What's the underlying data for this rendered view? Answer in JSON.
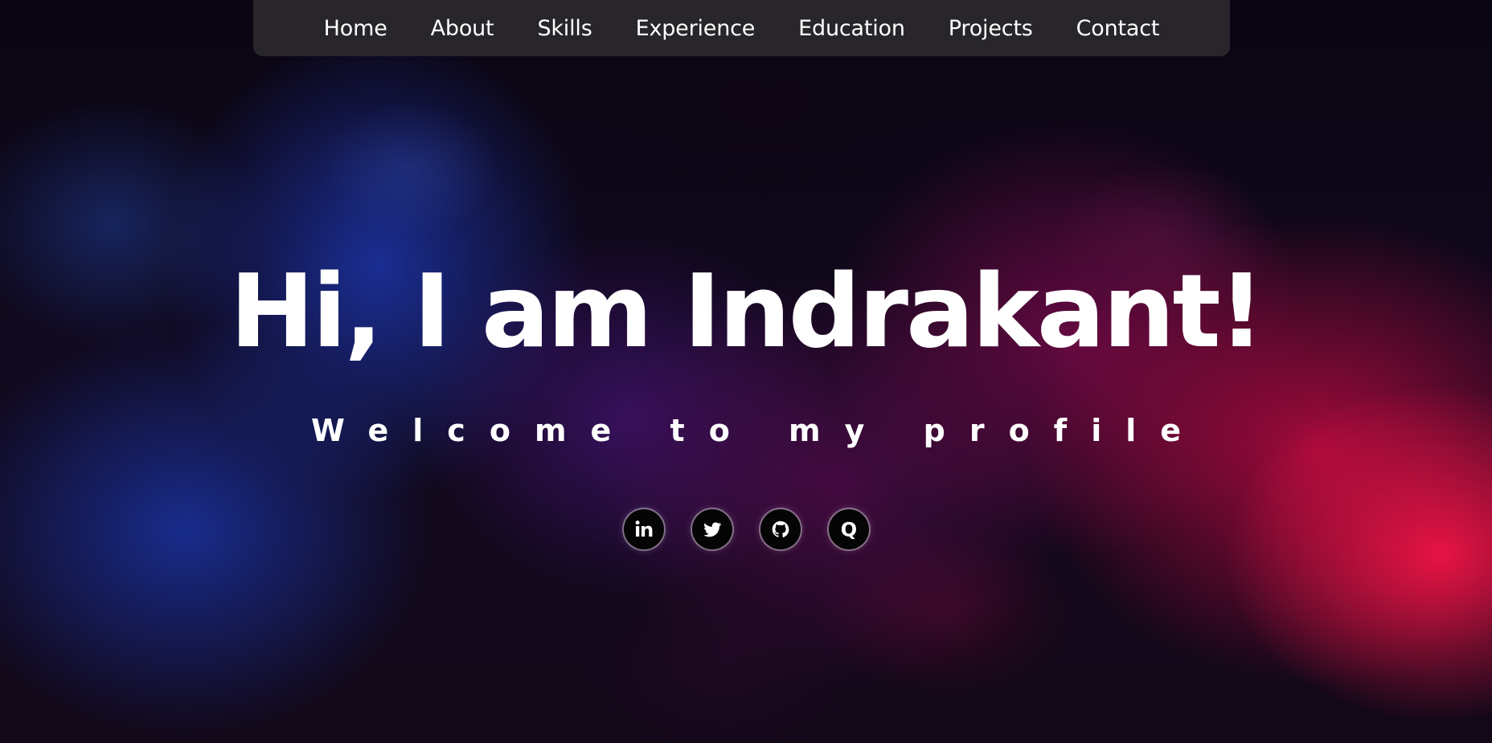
{
  "nav": {
    "items": [
      {
        "label": "Home"
      },
      {
        "label": "About"
      },
      {
        "label": "Skills"
      },
      {
        "label": "Experience"
      },
      {
        "label": "Education"
      },
      {
        "label": "Projects"
      },
      {
        "label": "Contact"
      }
    ]
  },
  "hero": {
    "headline": "Hi, I am Indrakant!",
    "subtitle": "Welcome to my profile"
  },
  "socials": {
    "items": [
      {
        "icon": "linkedin-icon"
      },
      {
        "icon": "twitter-icon"
      },
      {
        "icon": "github-icon"
      },
      {
        "icon": "quora-icon"
      }
    ]
  },
  "colors": {
    "nav_background": "#2a282c",
    "text": "#ffffff",
    "icon_background": "#050505",
    "smoke_blue": "#1c34a8",
    "smoke_red": "#f01446"
  }
}
